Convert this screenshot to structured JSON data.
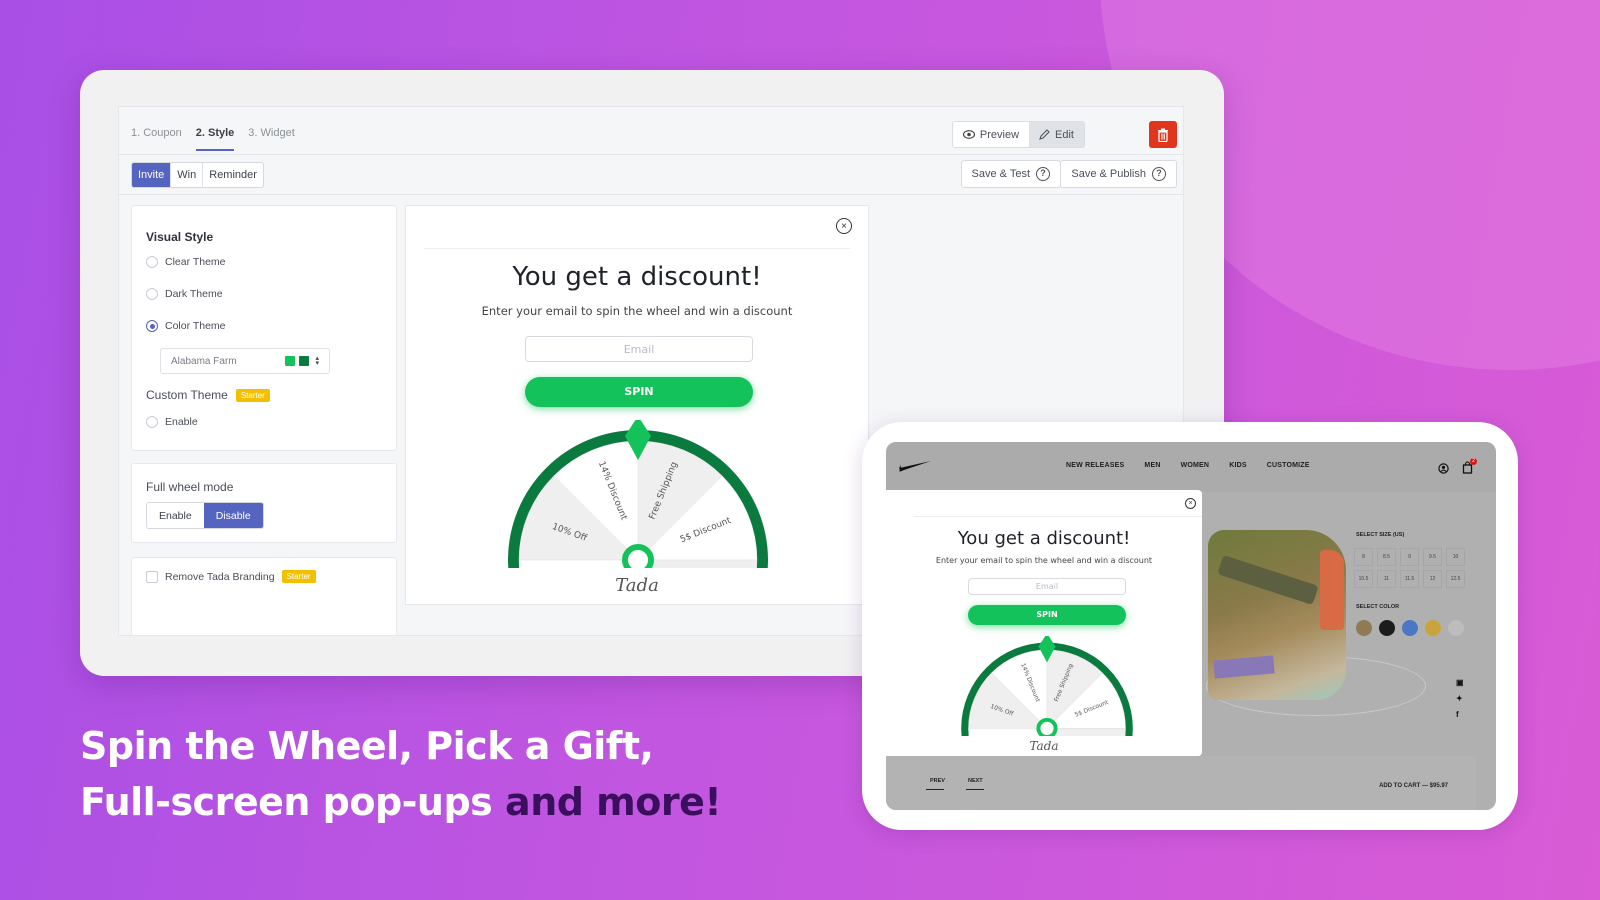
{
  "admin": {
    "steps": [
      {
        "label": "1. Coupon",
        "active": false
      },
      {
        "label": "2. Style",
        "active": true
      },
      {
        "label": "3. Widget",
        "active": false
      }
    ],
    "view_buttons": {
      "preview": "Preview",
      "edit": "Edit",
      "active": "edit"
    },
    "message_tabs": [
      {
        "label": "Invite",
        "active": true
      },
      {
        "label": "Win",
        "active": false
      },
      {
        "label": "Reminder",
        "active": false
      }
    ],
    "save_test": "Save & Test",
    "save_publish": "Save & Publish",
    "help_glyph": "?",
    "visual_style": {
      "title": "Visual Style",
      "options": [
        {
          "label": "Clear Theme",
          "checked": false
        },
        {
          "label": "Dark Theme",
          "checked": false
        },
        {
          "label": "Color Theme",
          "checked": true
        }
      ],
      "theme_select": {
        "value": "Alabama Farm",
        "swatches": [
          "#14c25c",
          "#0a7a3f"
        ]
      },
      "custom_theme": {
        "label": "Custom Theme",
        "badge": "Starter",
        "option": "Enable"
      }
    },
    "full_wheel": {
      "title": "Full wheel mode",
      "options": [
        "Enable",
        "Disable"
      ],
      "selected": "Disable"
    },
    "branding": {
      "label": "Remove Tada Branding",
      "badge": "Starter",
      "checked": false
    }
  },
  "popup": {
    "close_glyph": "×",
    "title": "You get a discount!",
    "subtitle": "Enter your email to spin the wheel and win a discount",
    "email_placeholder": "Email",
    "spin_label": "SPIN",
    "brand": "Tada",
    "wheel": {
      "segments": [
        "14% Discount",
        "Free Shipping",
        "5$ Discount",
        "10% Off"
      ],
      "ring_color": "#0b7a3e",
      "pointer_color": "#14c25c"
    }
  },
  "store": {
    "nav": [
      "NEW RELEASES",
      "MEN",
      "WOMEN",
      "KIDS",
      "CUSTOMIZE"
    ],
    "cart_count": "2",
    "size_label": "SELECT SIZE (US)",
    "sizes": [
      "8",
      "8.5",
      "9",
      "9.5",
      "10",
      "10.5",
      "11",
      "11.5",
      "12",
      "12.5"
    ],
    "color_label": "SELECT COLOR",
    "colors": [
      "#8f7a55",
      "#1c1c1c",
      "#4a78c4",
      "#c9a43a",
      "#bdbdbd"
    ],
    "prev": "PREV",
    "next": "NEXT",
    "add_to_cart": "ADD TO CART — $95.97"
  },
  "headline": {
    "line1": "Spin the Wheel, Pick a Gift,",
    "line2_light": "Full-screen pop-ups ",
    "line2_dark": "and more!"
  }
}
